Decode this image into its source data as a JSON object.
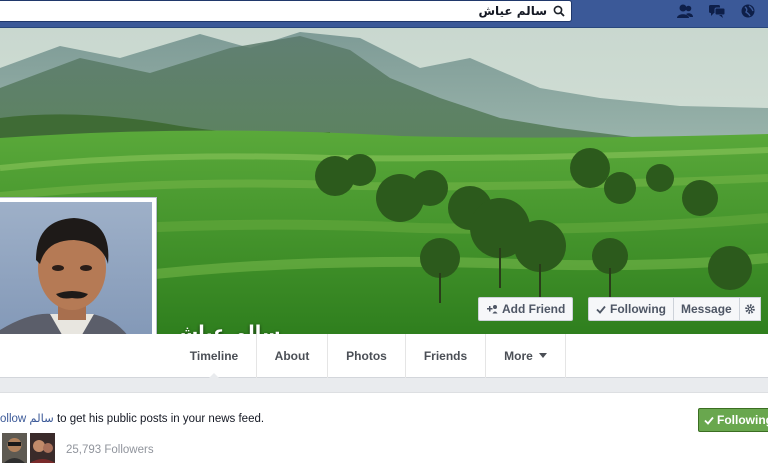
{
  "search": {
    "value": "سالم عياش"
  },
  "top_icons": [
    "friend-requests-icon",
    "messages-icon",
    "notifications-globe-icon"
  ],
  "profile": {
    "name": "سالم عياش"
  },
  "actions": {
    "add_friend": "Add Friend",
    "following": "Following",
    "message": "Message",
    "settings_icon": "gear-icon"
  },
  "tabs": [
    {
      "label": "Timeline",
      "active": true
    },
    {
      "label": "About"
    },
    {
      "label": "Photos"
    },
    {
      "label": "Friends"
    },
    {
      "label": "More"
    }
  ],
  "follow_panel": {
    "follow_link": "ollow",
    "name": "سالم",
    "rest": "to get his public posts in your news feed.",
    "followers_count": "25,793 Followers",
    "following_button": "Following"
  },
  "colors": {
    "topbar": "#3b5998",
    "link": "#3b5998",
    "following_green": "#69a74e",
    "page_bg": "#e9ebee"
  }
}
